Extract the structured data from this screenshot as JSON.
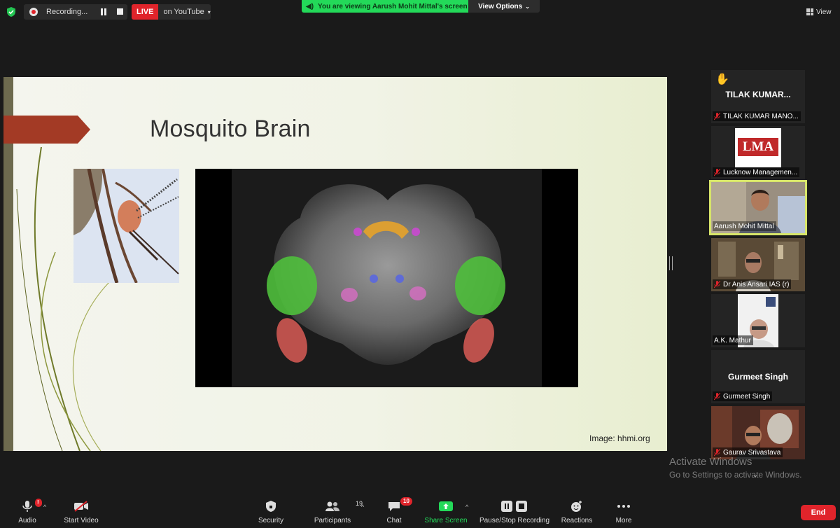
{
  "top": {
    "recording_label": "Recording...",
    "live_badge": "LIVE",
    "live_target": "on YouTube",
    "viewing_banner": "You are viewing Aarush Mohit Mittal's screen",
    "view_options": "View Options",
    "view": "View"
  },
  "slide": {
    "title": "Mosquito Brain",
    "credit": "Image: hhmi.org"
  },
  "participants": [
    {
      "big": "TILAK KUMAR...",
      "name": "TILAK KUMAR MANO...",
      "raised_hand": true
    },
    {
      "logo": "LMA",
      "name": "Lucknow Managemen..."
    },
    {
      "name": "Aarush Mohit Mittal",
      "active": true
    },
    {
      "name": "Dr Anis Ansari IAS (r)"
    },
    {
      "name": "A.K. Mathur"
    },
    {
      "big": "Gurmeet Singh",
      "name": "Gurmeet Singh"
    },
    {
      "name": "Gaurav Srivastava"
    }
  ],
  "watermark": {
    "line1": "Activate Windows",
    "line2": "Go to Settings to activate Windows."
  },
  "toolbar": {
    "audio": "Audio",
    "start_video": "Start Video",
    "security": "Security",
    "participants": "Participants",
    "participants_count": "19",
    "chat": "Chat",
    "chat_count": "10",
    "share_screen": "Share Screen",
    "pause_recording": "Pause/Stop Recording",
    "reactions": "Reactions",
    "more": "More",
    "end": "End"
  },
  "colors": {
    "live": "#e0242b",
    "share_green": "#23d959",
    "active_speaker": "#d7e56a",
    "slide_arrow": "#a33a25"
  }
}
